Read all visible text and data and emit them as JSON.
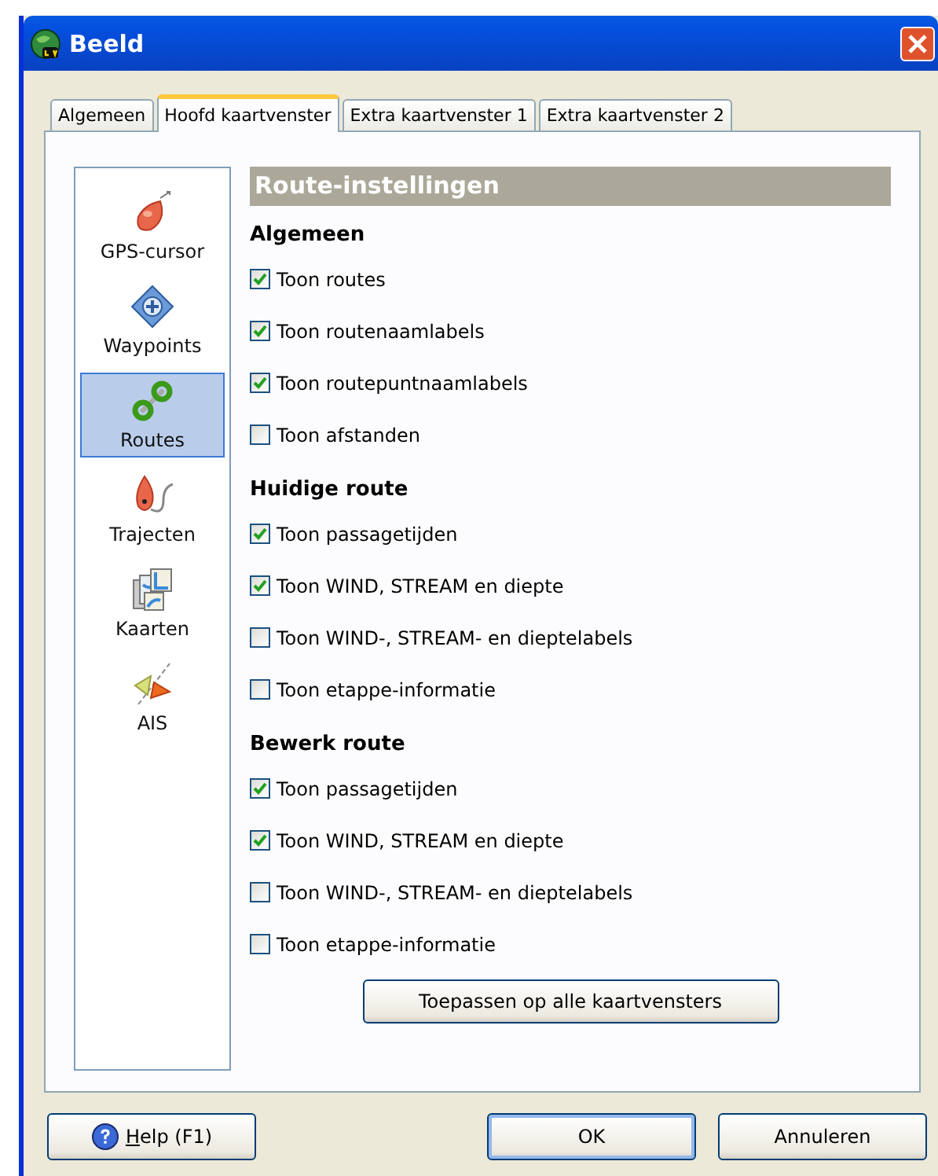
{
  "window": {
    "title": "Beeld"
  },
  "tabs": [
    {
      "label": "Algemeen",
      "selected": false
    },
    {
      "label": "Hoofd kaartvenster",
      "selected": true
    },
    {
      "label": "Extra kaartvenster 1",
      "selected": false
    },
    {
      "label": "Extra kaartvenster 2",
      "selected": false
    }
  ],
  "sidebar": {
    "items": [
      {
        "label": "GPS-cursor",
        "kind": "cursor",
        "selected": false
      },
      {
        "label": "Waypoints",
        "kind": "waypoint",
        "selected": false
      },
      {
        "label": "Routes",
        "kind": "route",
        "selected": true
      },
      {
        "label": "Trajecten",
        "kind": "track",
        "selected": false
      },
      {
        "label": "Kaarten",
        "kind": "maps",
        "selected": false
      },
      {
        "label": "AIS",
        "kind": "ais",
        "selected": false
      }
    ]
  },
  "panel": {
    "title": "Route-instellingen",
    "sections": [
      {
        "heading": "Algemeen",
        "options": [
          {
            "label": "Toon routes",
            "checked": true
          },
          {
            "label": "Toon routenaamlabels",
            "checked": true
          },
          {
            "label": "Toon routepuntnaamlabels",
            "checked": true
          },
          {
            "label": "Toon afstanden",
            "checked": false
          }
        ]
      },
      {
        "heading": "Huidige route",
        "options": [
          {
            "label": "Toon passagetijden",
            "checked": true
          },
          {
            "label": "Toon WIND, STREAM en diepte",
            "checked": true
          },
          {
            "label": "Toon WIND-, STREAM- en dieptelabels",
            "checked": false
          },
          {
            "label": "Toon etappe-informatie",
            "checked": false
          }
        ]
      },
      {
        "heading": "Bewerk route",
        "options": [
          {
            "label": "Toon passagetijden",
            "checked": true
          },
          {
            "label": "Toon WIND, STREAM en diepte",
            "checked": true
          },
          {
            "label": "Toon WIND-, STREAM- en dieptelabels",
            "checked": false
          },
          {
            "label": "Toon etappe-informatie",
            "checked": false
          }
        ]
      }
    ],
    "apply_button": "Toepassen op alle kaartvensters"
  },
  "buttons": [
    {
      "label": "Help (F1)",
      "kind": "help",
      "underline_first": true
    },
    {
      "label": "OK",
      "kind": "default"
    },
    {
      "label": "Annuleren",
      "kind": "plain"
    }
  ]
}
